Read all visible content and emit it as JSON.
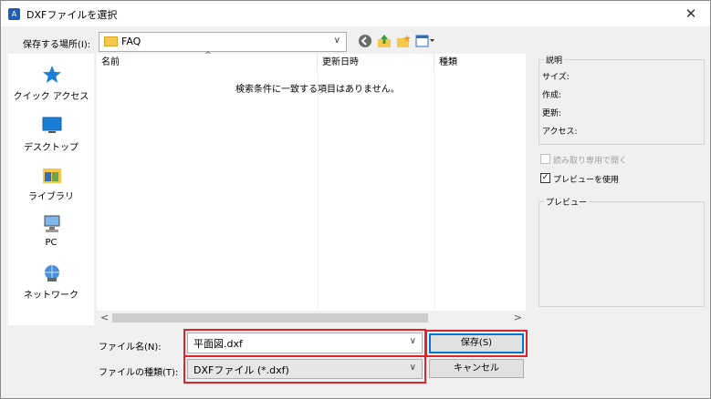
{
  "window": {
    "title": "DXFファイルを選択"
  },
  "toolbar": {
    "save_in_label": "保存する場所(I):",
    "location_value": "FAQ"
  },
  "places": [
    {
      "label": "クイック アクセス",
      "icon": "star-icon"
    },
    {
      "label": "デスクトップ",
      "icon": "desktop-icon"
    },
    {
      "label": "ライブラリ",
      "icon": "library-icon"
    },
    {
      "label": "PC",
      "icon": "pc-icon"
    },
    {
      "label": "ネットワーク",
      "icon": "network-icon"
    }
  ],
  "file_list": {
    "columns": [
      "名前",
      "更新日時",
      "種類"
    ],
    "empty_message": "検索条件に一致する項目はありません。"
  },
  "form": {
    "filename_label": "ファイル名(N):",
    "filename_value": "平面図.dxf",
    "filetype_label": "ファイルの種類(T):",
    "filetype_value": "DXFファイル (*.dxf)",
    "save_button": "保存(S)",
    "cancel_button": "キャンセル"
  },
  "info_panel": {
    "title": "説明",
    "size_label": "サイズ:",
    "created_label": "作成:",
    "updated_label": "更新:",
    "access_label": "アクセス:",
    "readonly_label": "読み取り専用で開く",
    "readonly_checked": false,
    "use_preview_label": "プレビューを使用",
    "use_preview_checked": true,
    "preview_title": "プレビュー"
  },
  "colors": {
    "accent": "#0078d7",
    "highlight": "#e0242b"
  }
}
